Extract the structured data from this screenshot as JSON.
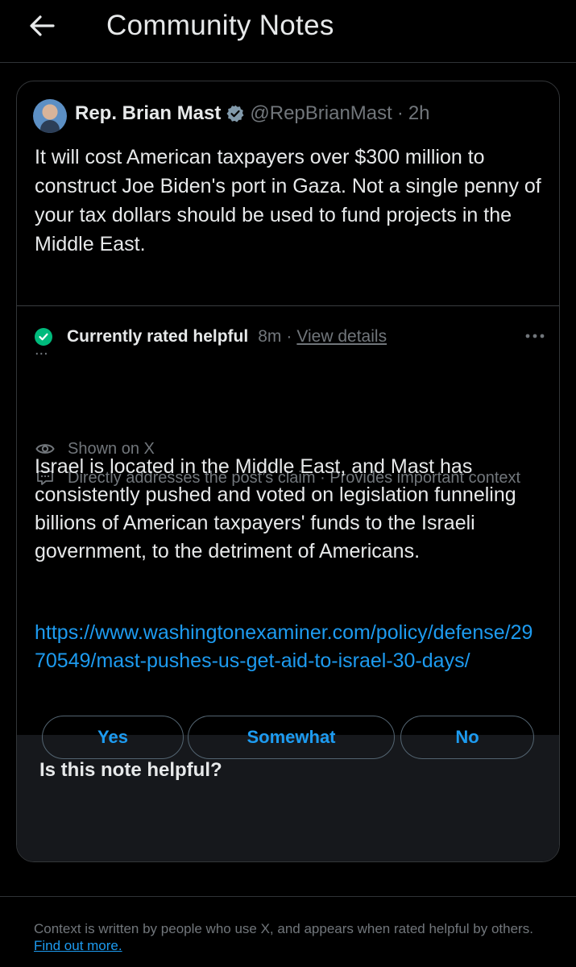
{
  "header": {
    "title": "Community Notes",
    "back_icon": "arrow-left-icon"
  },
  "post": {
    "author_name": "Rep. Brian Mast",
    "verified_icon": "verified-badge-icon",
    "verified_color": "#829aab",
    "handle": "@RepBrianMast",
    "separator": "·",
    "time": "2h",
    "text": "It will cost American taxpayers over $300 million to construct Joe Biden's port in Gaza. Not a single penny of your tax dollars should be used to fund projects in the Middle East.",
    "truncation": "..."
  },
  "note": {
    "status_icon": "check-circle-icon",
    "status_color": "#00ba7c",
    "status_label": "Currently rated helpful",
    "time": "8m",
    "separator": "·",
    "view_details": "View details",
    "more_icon": "more-horizontal-icon",
    "shown_icon": "eye-icon",
    "shown_text": "Shown on X",
    "reasons_icon": "message-dots-icon",
    "reasons_text": "Directly addresses the post’s claim · Provides important context",
    "text": "Israel is located in the Middle East, and Mast has consistently pushed and voted on legislation funneling billions of American taxpayers' funds to the Israeli government, to the detriment of Americans.",
    "link": "https://www.washingtonexaminer.com/policy/defense/2970549/mast-pushes-us-get-aid-to-israel-30-days/",
    "link_color": "#1d9bf0"
  },
  "rating": {
    "question": "Is this note helpful?",
    "yes": "Yes",
    "somewhat": "Somewhat",
    "no": "No"
  },
  "footer": {
    "text": "Context is written by people who use X, and appears when rated helpful by others. ",
    "link": "Find out more."
  }
}
